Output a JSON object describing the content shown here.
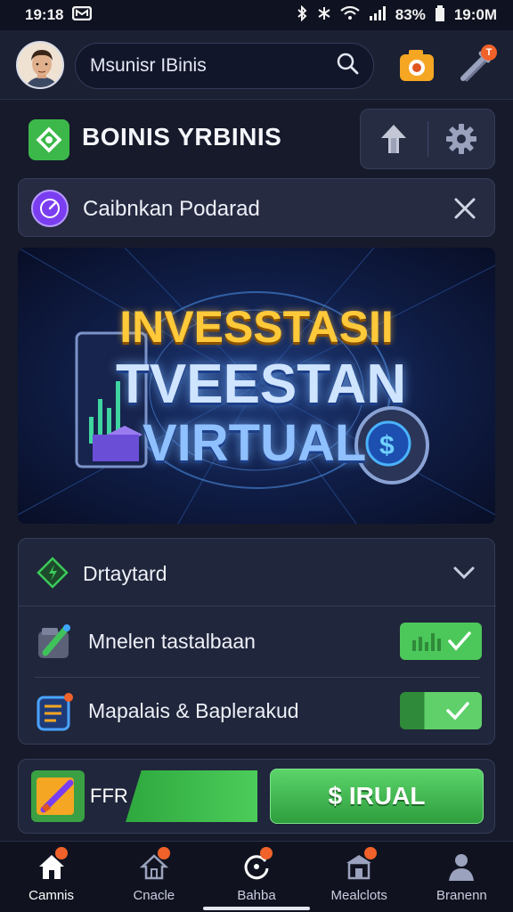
{
  "status_bar": {
    "time_left": "19:18",
    "battery": "83%",
    "time_right": "19:0M"
  },
  "top_bar": {
    "search": {
      "value": "Msunisr IBinis"
    },
    "tool_badge": "T"
  },
  "title_bar": {
    "title": "BOINIS YRBINIS"
  },
  "notice": {
    "text": "Caibnkan Podarad"
  },
  "banner": {
    "line1": "INVESSTASII",
    "line2": "TVEESTAN",
    "line3": "VIRTUAL"
  },
  "panel": {
    "title": "Drtaytard",
    "rows": [
      {
        "label": "Mnelen tastalbaan",
        "toggle_on": true
      },
      {
        "label": "Mapalais & Baplerakud",
        "toggle_on": true
      }
    ]
  },
  "action_bar": {
    "label": "FFR",
    "cta": "$ IRUAL"
  },
  "nav": [
    {
      "label": "Camnis",
      "icon": "home-icon",
      "active": true
    },
    {
      "label": "Cnacle",
      "icon": "house-outline-icon",
      "active": false
    },
    {
      "label": "Bahba",
      "icon": "refresh-circle-icon",
      "active": false
    },
    {
      "label": "Mealclots",
      "icon": "store-icon",
      "active": false
    },
    {
      "label": "Branenn",
      "icon": "person-icon",
      "active": false
    }
  ],
  "colors": {
    "accent_green": "#3cb84a",
    "badge_orange": "#f0622a",
    "background": "#161a2b"
  }
}
